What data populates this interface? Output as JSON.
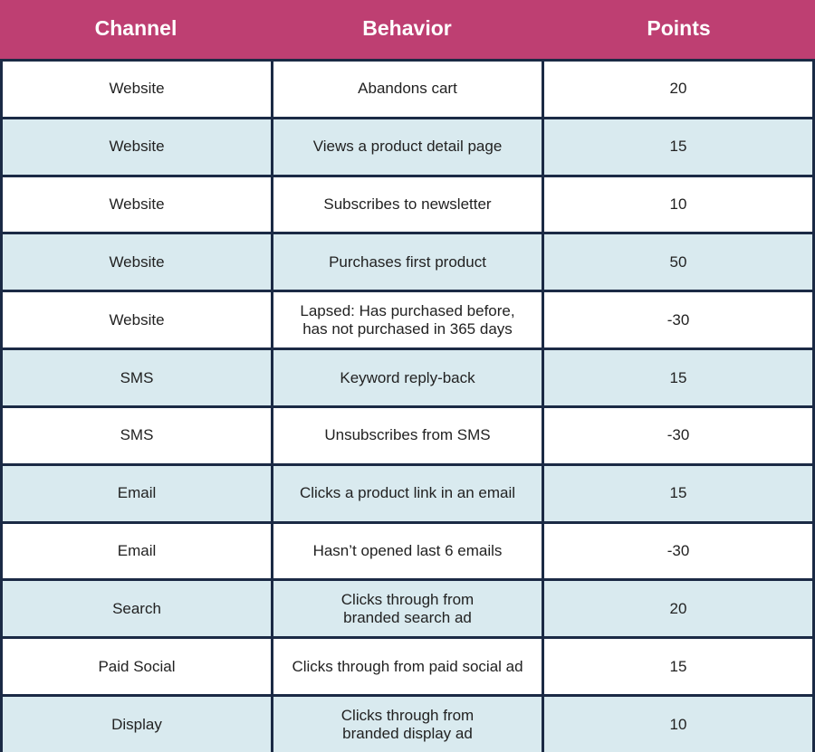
{
  "table": {
    "colors": {
      "header_bg": "#BE3F72",
      "header_text": "#FFFFFF",
      "border": "#1B2A45",
      "row_alt_bg": "#D9EAEF",
      "row_bg": "#FFFFFF",
      "text": "#222222"
    },
    "headers": [
      "Channel",
      "Behavior",
      "Points"
    ],
    "rows": [
      {
        "channel": "Website",
        "behavior": "Abandons cart",
        "points": "20"
      },
      {
        "channel": "Website",
        "behavior": "Views a product detail page",
        "points": "15"
      },
      {
        "channel": "Website",
        "behavior": "Subscribes to newsletter",
        "points": "10"
      },
      {
        "channel": "Website",
        "behavior": "Purchases first product",
        "points": "50"
      },
      {
        "channel": "Website",
        "behavior": "Lapsed: Has purchased before,\nhas not purchased in 365 days",
        "points": "-30"
      },
      {
        "channel": "SMS",
        "behavior": "Keyword reply-back",
        "points": "15"
      },
      {
        "channel": "SMS",
        "behavior": "Unsubscribes from SMS",
        "points": "-30"
      },
      {
        "channel": "Email",
        "behavior": "Clicks a product link in an email",
        "points": "15"
      },
      {
        "channel": "Email",
        "behavior": "Hasn’t opened last 6 emails",
        "points": "-30"
      },
      {
        "channel": "Search",
        "behavior": "Clicks through from\nbranded search ad",
        "points": "20"
      },
      {
        "channel": "Paid Social",
        "behavior": "Clicks through from paid social ad",
        "points": "15"
      },
      {
        "channel": "Display",
        "behavior": "Clicks through from\nbranded display ad",
        "points": "10"
      }
    ]
  }
}
